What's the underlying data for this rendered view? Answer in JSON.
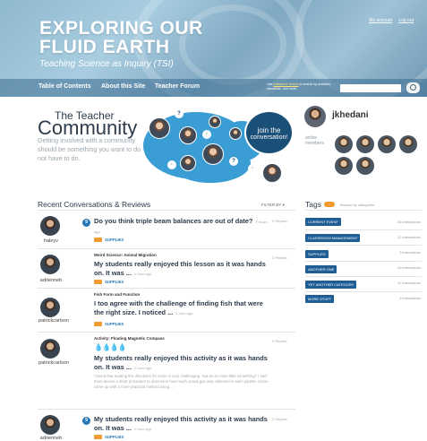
{
  "header": {
    "title_line1": "EXPLORING OUR",
    "title_line2": "FLUID EARTH",
    "subtitle": "Teaching Science as Inquiry (TSI)",
    "account_link": "My account",
    "logout_link": "Log out",
    "colors": {
      "banner": "#8fb9cf",
      "nav": "#3c6e91"
    }
  },
  "nav": {
    "items": [
      "Table of Contents",
      "About this Site",
      "Teacher Forum"
    ],
    "search_hint_prefix": "Use",
    "search_hint_link": "Advanced Search",
    "search_hint_suffix": "to search by activities, standards, and more."
  },
  "community": {
    "title_small": "The Teacher",
    "title_large": "Community",
    "description": "Getting involved with a community should be something you want to do - not have to do.",
    "join_line1": "join the",
    "join_line2": "conversation!",
    "accent": "#3a9dd4"
  },
  "user": {
    "username": "jkhedani",
    "active_label": "active members"
  },
  "conversations": {
    "heading": "Recent Conversations & Reviews",
    "filter_label": "FILTER BY",
    "items": [
      {
        "user": "haleyv",
        "badge": "9",
        "category": "",
        "title": "Do you think triple beam balances are out of date?",
        "ago": "7 hours ago",
        "replies": "3 Replies",
        "tag": "SUPPLIES",
        "excerpt": ""
      },
      {
        "user": "adrienneb",
        "badge": "",
        "category": "Weird Science: Animal Migration",
        "title": "My students really enjoyed this lesson as it was hands on. It was ...",
        "ago": "1 hour ago",
        "replies": "3 Replies",
        "tag": "SUPPLIES",
        "excerpt": ""
      },
      {
        "user": "patrickcarlson",
        "badge": "",
        "category": "Fish Form and Function",
        "title": "I too agree with the challenge of finding fish that were the right size. I noticed ...",
        "ago": "1 hour ago",
        "replies": "",
        "tag": "SUPPLIES",
        "excerpt": ""
      },
      {
        "user": "patrickcarlson",
        "badge": "",
        "category": "Activity: Floating Magnetic Compass",
        "rating": "💧💧💧💧",
        "title": "My students really enjoyed this activity as it was hands on. It was ...",
        "ago": "1 hour ago",
        "replies": "3 Replies",
        "tag": "",
        "excerpt": "I found that reading the directions for some is very challenging. Not as an extra little something? I had them devise a short procedure to determine how much actual gas was collected in each pipette. Some came up with a more practical method using ..."
      },
      {
        "user": "adrienneb",
        "badge": "9",
        "category": "",
        "title": "My students really enjoyed this activity as it was hands on. It was ...",
        "ago": "1 hour ago",
        "replies": "3 Replies",
        "tag": "SUPPLIES",
        "excerpt": ""
      }
    ]
  },
  "tags": {
    "heading": "Tags",
    "hint": "Browse by categories",
    "items": [
      {
        "label": "CURRENT EVENT",
        "count": "45 interactions"
      },
      {
        "label": "CLASSROOM MANAGEMENT",
        "count": "12 interactions"
      },
      {
        "label": "SUPPLIES",
        "count": "3 interactions"
      },
      {
        "label": "ANOTHER ONE",
        "count": "45 interactions"
      },
      {
        "label": "YET ANOTHER CATEGORY",
        "count": "12 interactions"
      },
      {
        "label": "MORE STUFF",
        "count": "3 interactions"
      }
    ]
  }
}
